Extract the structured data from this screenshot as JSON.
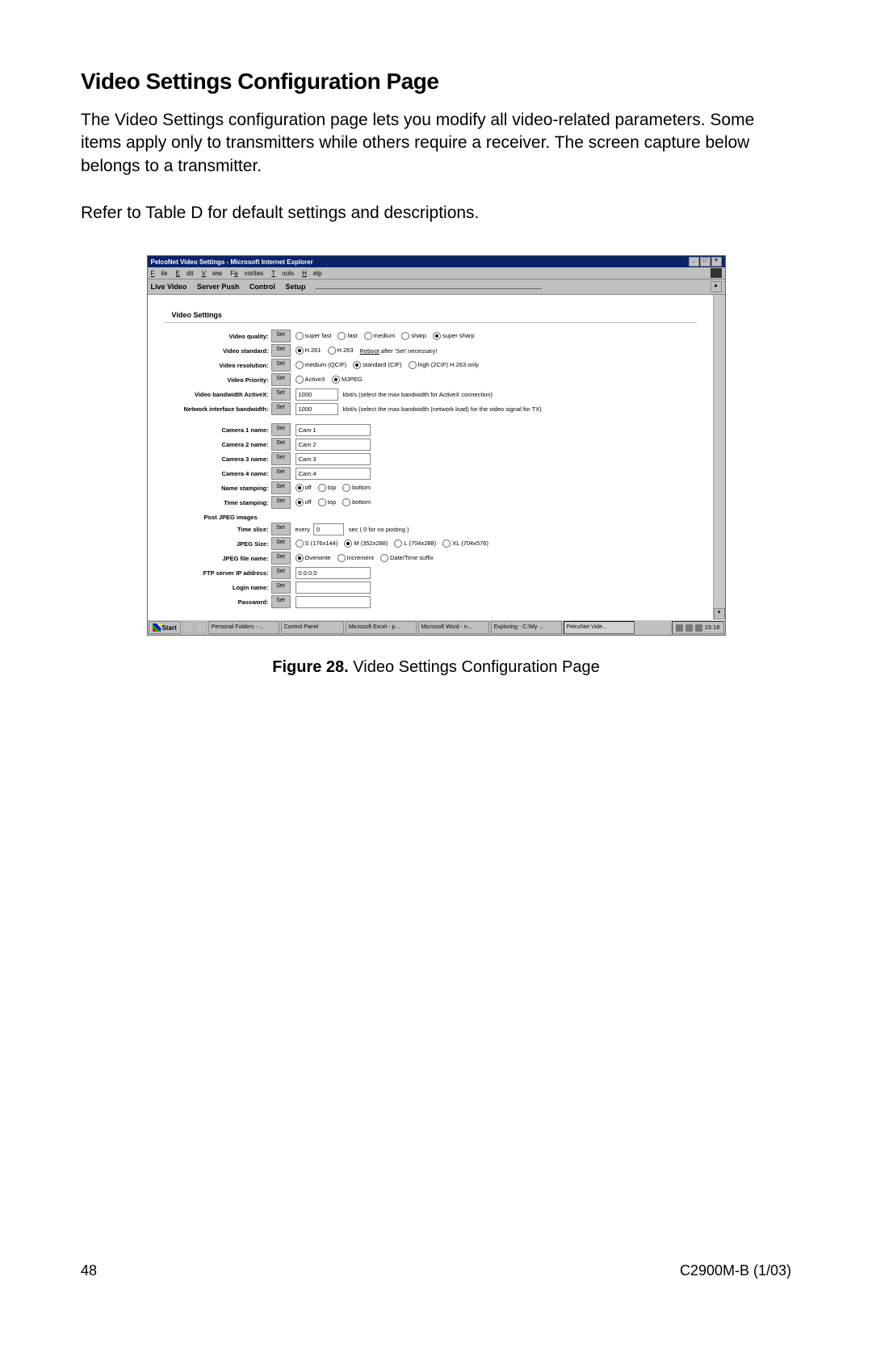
{
  "heading": "Video Settings Configuration Page",
  "intro": "The Video Settings configuration page lets you modify all video-related parameters. Some items apply only to transmitters while others require a receiver. The screen capture below belongs to a transmitter.",
  "ref": "Refer to Table D for default settings and descriptions.",
  "window": {
    "title": "PelcoNet Video Settings - Microsoft Internet Explorer",
    "menus": [
      "File",
      "Edit",
      "View",
      "Favorites",
      "Tools",
      "Help"
    ],
    "tabs": [
      "Live Video",
      "Server Push",
      "Control",
      "Setup"
    ]
  },
  "section_title": "Video Settings",
  "set_label": "Set",
  "rows": {
    "video_quality": {
      "label": "Video quality:",
      "options": [
        "super fast",
        "fast",
        "medium",
        "sharp",
        "super sharp"
      ],
      "selected": 4
    },
    "video_standard": {
      "label": "Video standard:",
      "options": [
        "H.261",
        "H.263"
      ],
      "selected": 0,
      "note_link": "Reboot",
      "note_rest": " after 'Set' necessary!"
    },
    "video_resolution": {
      "label": "Video resolution:",
      "options": [
        "medium (QCIF)",
        "standard (CIF)",
        "high (2CIF) H.263 only"
      ],
      "selected": 1
    },
    "video_priority": {
      "label": "Video Priority:",
      "options": [
        "ActiveX",
        "MJPEG"
      ],
      "selected": 1
    },
    "bandwidth_activex": {
      "label": "Video bandwidth ActiveX:",
      "value": "1000",
      "hint": "kbit/s (select the max bandwidth for ActiveX connection)"
    },
    "bandwidth_net": {
      "label": "Network interface bandwidth:",
      "value": "1000",
      "hint": "kbit/s (select the max bandwidth (network load) for the video signal for TX)"
    },
    "cam1": {
      "label": "Camera 1 name:",
      "value": "Cam 1"
    },
    "cam2": {
      "label": "Camera 2 name:",
      "value": "Cam 2"
    },
    "cam3": {
      "label": "Camera 3 name:",
      "value": "Cam 3"
    },
    "cam4": {
      "label": "Camera 4 name:",
      "value": "Cam 4"
    },
    "name_stamping": {
      "label": "Name stamping:",
      "options": [
        "off",
        "top",
        "bottom"
      ],
      "selected": 0
    },
    "time_stamping": {
      "label": "Time stamping:",
      "options": [
        "off",
        "top",
        "bottom"
      ],
      "selected": 0
    },
    "post_jpeg_head": "Post JPEG images",
    "time_slice": {
      "label": "Time slice:",
      "prefix": "every",
      "value": "0",
      "suffix": "sec  ( 0 for no posting )"
    },
    "jpeg_size": {
      "label": "JPEG Size:",
      "options": [
        "S (176x144)",
        "M (352x288)",
        "L (704x288)",
        "XL (704x576)"
      ],
      "selected": 1
    },
    "jpeg_filename": {
      "label": "JPEG file name:",
      "options": [
        "Overwrite",
        "Increment",
        "Date/Time suffix"
      ],
      "selected": 0
    },
    "ftp_ip": {
      "label": "FTP server IP address:",
      "value": "0.0.0.0"
    },
    "login_name": {
      "label": "Login name:",
      "value": ""
    },
    "password": {
      "label": "Password:",
      "value": ""
    }
  },
  "taskbar": {
    "start": "Start",
    "items": [
      "Personal Folders - ...",
      "Control Panel",
      "Microsoft Excel - p...",
      "Microsoft Word - n...",
      "Exploring - C:\\My ...",
      "PelcoNet Vide..."
    ],
    "active_index": 5,
    "clock": "15:18"
  },
  "caption_bold": "Figure 28.",
  "caption_rest": "  Video Settings Configuration Page",
  "footer": {
    "page": "48",
    "doc": "C2900M-B (1/03)"
  }
}
